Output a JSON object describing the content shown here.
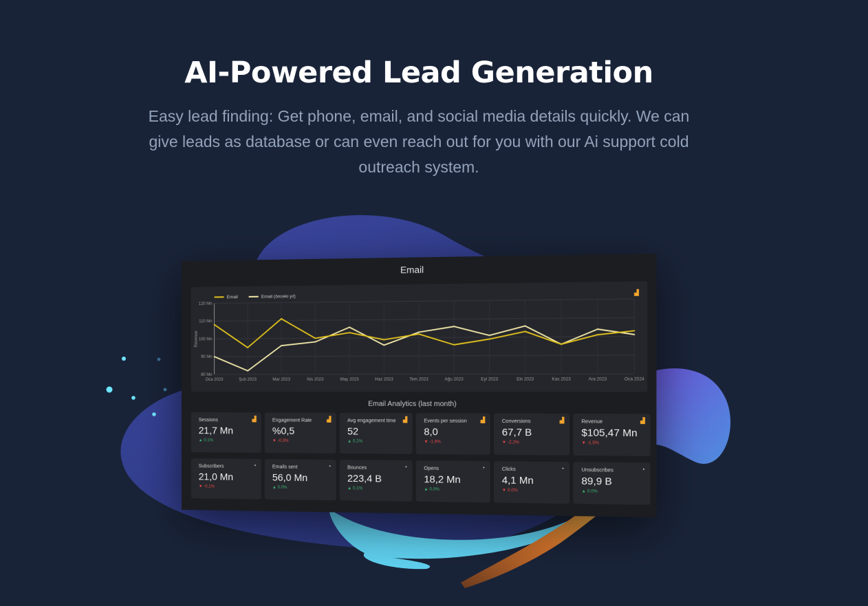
{
  "hero": {
    "title": "AI-Powered Lead Generation",
    "subtitle": "Easy lead finding: Get phone, email, and social media details quickly. We can give leads as database or can even reach out for you with our Ai support cold outreach system."
  },
  "dashboard": {
    "title": "Email",
    "section_title": "Email Analytics (last month)",
    "kpis_row1": [
      {
        "label": "Sessions",
        "value": "21,7 Mn",
        "delta": "0.1%",
        "dir": "up",
        "icon": "bar-chart-icon"
      },
      {
        "label": "Engagement Rate",
        "value": "%0,5",
        "delta": "-0.3%",
        "dir": "down",
        "icon": "bar-chart-icon"
      },
      {
        "label": "Avg engagement time",
        "value": "52",
        "delta": "0.2%",
        "dir": "up",
        "icon": "bar-chart-icon"
      },
      {
        "label": "Events per session",
        "value": "8,0",
        "delta": "-1.9%",
        "dir": "down",
        "icon": "bar-chart-icon"
      },
      {
        "label": "Conversions",
        "value": "67,7 B",
        "delta": "-2.2%",
        "dir": "down",
        "icon": "bar-chart-icon"
      },
      {
        "label": "Revenue",
        "value": "$105,47 Mn",
        "delta": "-1.5%",
        "dir": "down",
        "icon": "bar-chart-icon"
      }
    ],
    "kpis_row2": [
      {
        "label": "Subscribers",
        "value": "21,0 Mn",
        "delta": "-0.1%",
        "dir": "down",
        "icon": "analytics-icon"
      },
      {
        "label": "Emails sent",
        "value": "56,0 Mn",
        "delta": "0.0%",
        "dir": "up",
        "icon": "analytics-icon"
      },
      {
        "label": "Bounces",
        "value": "223,4 B",
        "delta": "0.1%",
        "dir": "up",
        "icon": "analytics-icon"
      },
      {
        "label": "Opens",
        "value": "18,2 Mn",
        "delta": "0.0%",
        "dir": "up",
        "icon": "analytics-icon"
      },
      {
        "label": "Clicks",
        "value": "4,1 Mn",
        "delta": "0.0%",
        "dir": "down",
        "icon": "analytics-icon"
      },
      {
        "label": "Unsubscribes",
        "value": "89,9 B",
        "delta": "0.0%",
        "dir": "up",
        "icon": "analytics-icon"
      }
    ]
  },
  "chart_data": {
    "type": "line",
    "title": "",
    "xlabel": "",
    "ylabel": "Revenue",
    "x": [
      "Oca 2023",
      "Şub 2023",
      "Mar 2023",
      "Nis 2023",
      "May 2023",
      "Haz 2023",
      "Tem 2023",
      "Ağu 2023",
      "Eyl 2023",
      "Eki 2023",
      "Kas 2023",
      "Ara 2023",
      "Oca 2024"
    ],
    "y_ticks": [
      "80 Mn",
      "90 Mn",
      "100 Mn",
      "110 Mn",
      "120 Mn"
    ],
    "ylim": [
      80,
      120
    ],
    "grid": true,
    "legend": "top-left",
    "series": [
      {
        "name": "Email",
        "color": "#e2c21c",
        "values": [
          108,
          95,
          111,
          100,
          103,
          99,
          102,
          96,
          99,
          103,
          96,
          101,
          103
        ]
      },
      {
        "name": "Email (önceki yıl)",
        "color": "#efe6a8",
        "values": [
          90,
          82,
          96,
          98,
          106,
          96,
          103,
          106,
          101,
          106,
          96,
          104,
          101
        ]
      }
    ]
  },
  "colors": {
    "background": "#192338",
    "blob_purple": "#3f4aa6",
    "accent_cyan": "#5fd1f0",
    "accent_orange": "#f5a43b"
  }
}
